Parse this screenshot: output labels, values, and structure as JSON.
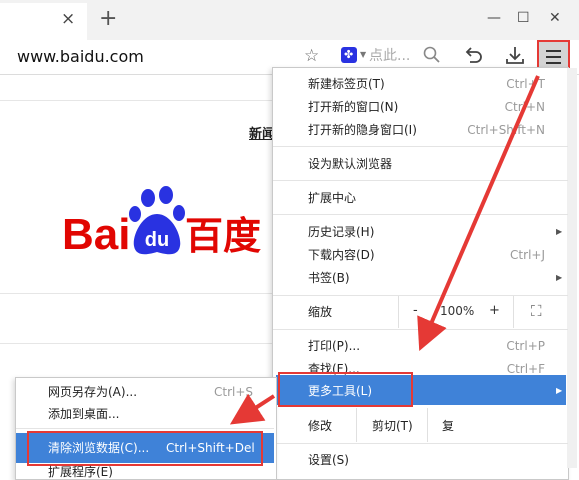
{
  "tabs": {
    "close_glyph": "×",
    "new_tab_glyph": "+"
  },
  "window": {
    "minimize": "—",
    "maximize": "☐",
    "close": "✕"
  },
  "address": {
    "url": "www.baidu.com",
    "search_placeholder": "点此...",
    "star_icon": "star-icon",
    "accent": "#e53935"
  },
  "page": {
    "news_link": "新闻",
    "logo": {
      "text_left": "Bai",
      "paw_text": "du",
      "text_right": "百度",
      "red": "#e10602",
      "blue": "#2932e1"
    }
  },
  "main_menu": {
    "items": [
      {
        "label": "新建标签页(T)",
        "shortcut": "Ctrl+T"
      },
      {
        "label": "打开新的窗口(N)",
        "shortcut": "Ctrl+N"
      },
      {
        "label": "打开新的隐身窗口(I)",
        "shortcut": "Ctrl+Shift+N"
      },
      {
        "label": "设为默认浏览器",
        "shortcut": ""
      },
      {
        "label": "扩展中心",
        "shortcut": ""
      },
      {
        "label": "历史记录(H)",
        "shortcut": ""
      },
      {
        "label": "下载内容(D)",
        "shortcut": "Ctrl+J"
      },
      {
        "label": "书签(B)",
        "shortcut": ""
      },
      {
        "label": "打印(P)...",
        "shortcut": "Ctrl+P"
      },
      {
        "label": "查找(F)...",
        "shortcut": "Ctrl+F"
      },
      {
        "label": "更多工具(L)",
        "shortcut": ""
      },
      {
        "label": "设置(S)",
        "shortcut": ""
      }
    ],
    "zoom": {
      "label": "缩放",
      "minus": "-",
      "value": "100%",
      "plus": "+",
      "fullscreen": "⛶"
    },
    "edit": {
      "label": "修改",
      "cut": "剪切(T)",
      "copy": "复"
    },
    "highlight": "#3f82d8"
  },
  "sub_menu": {
    "items": [
      {
        "label": "网页另存为(A)...",
        "shortcut": "Ctrl+S"
      },
      {
        "label": "添加到桌面...",
        "shortcut": ""
      },
      {
        "label": "清除浏览数据(C)...",
        "shortcut": "Ctrl+Shift+Del"
      },
      {
        "label": "扩展程序(E)",
        "shortcut": ""
      }
    ]
  }
}
